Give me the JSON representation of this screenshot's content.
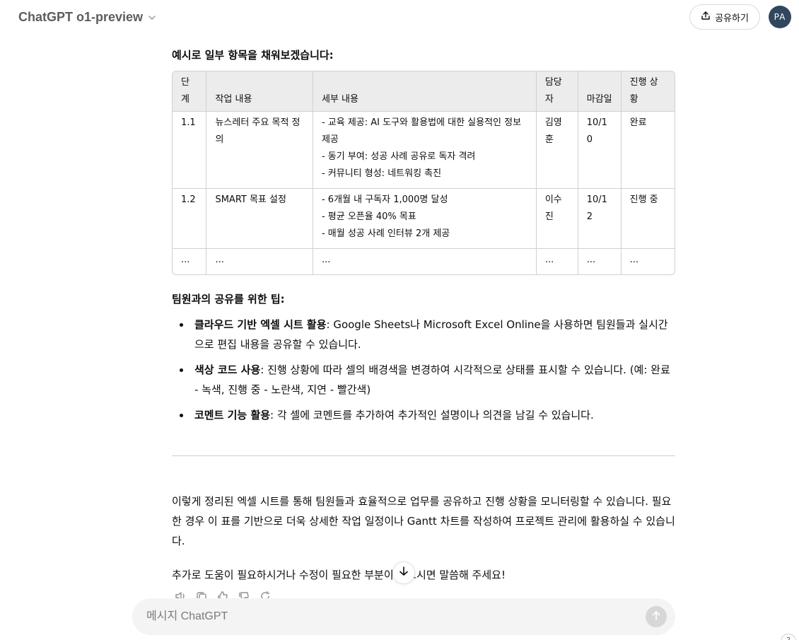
{
  "header": {
    "model_title": "ChatGPT o1-preview",
    "share_label": "공유하기",
    "avatar_initials": "PA"
  },
  "message": {
    "lead": "예시로 일부 항목을 채워보겠습니다:",
    "table": {
      "headers": [
        "단계",
        "작업 내용",
        "세부 내용",
        "담당자",
        "마감일",
        "진행 상황"
      ],
      "rows": [
        {
          "step": "1.1",
          "task": "뉴스레터 주요 목적 정의",
          "details": [
            "- 교육 제공: AI 도구와 활용법에 대한 실용적인 정보 제공",
            "- 동기 부여: 성공 사례 공유로 독자 격려",
            "- 커뮤니티 형성: 네트워킹 촉진"
          ],
          "owner": "김영훈",
          "due": "10/10",
          "status": "완료"
        },
        {
          "step": "1.2",
          "task": "SMART 목표 설정",
          "details": [
            "- 6개월 내 구독자 1,000명 달성",
            "- 평균 오픈율 40% 목표",
            "- 매월 성공 사례 인터뷰 2개 제공"
          ],
          "owner": "이수진",
          "due": "10/12",
          "status": "진행 중"
        },
        {
          "step": "...",
          "task": "...",
          "details": [
            "..."
          ],
          "owner": "...",
          "due": "...",
          "status": "..."
        }
      ]
    },
    "tips_heading": "팀원과의 공유를 위한 팁:",
    "tips": [
      {
        "bold": "클라우드 기반 엑셀 시트 활용",
        "text": ": Google Sheets나 Microsoft Excel Online을 사용하면 팀원들과 실시간으로 편집 내용을 공유할 수 있습니다."
      },
      {
        "bold": "색상 코드 사용",
        "text": ": 진행 상황에 따라 셀의 배경색을 변경하여 시각적으로 상태를 표시할 수 있습니다. (예: 완료 - 녹색, 진행 중 - 노란색, 지연 - 빨간색)"
      },
      {
        "bold": "코멘트 기능 활용",
        "text": ": 각 셀에 코멘트를 추가하여 추가적인 설명이나 의견을 남길 수 있습니다."
      }
    ],
    "closing_paragraph": "이렇게 정리된 엑셀 시트를 통해 팀원들과 효율적으로 업무를 공유하고 진행 상황을 모니터링할 수 있습니다. 필요한 경우 이 표를 기반으로 더욱 상세한 작업 일정이나 Gantt 차트를 작성하여 프로젝트 관리에 활용하실 수 있습니다.",
    "final_line": "추가로 도움이 필요하시거나 수정이 필요한 부분이 있으시면 말씀해 주세요!"
  },
  "message_actions": [
    "read-aloud-icon",
    "copy-icon",
    "thumbs-up-icon",
    "thumbs-down-icon",
    "regenerate-icon"
  ],
  "composer": {
    "placeholder": "메시지 ChatGPT"
  },
  "help_label": "?"
}
